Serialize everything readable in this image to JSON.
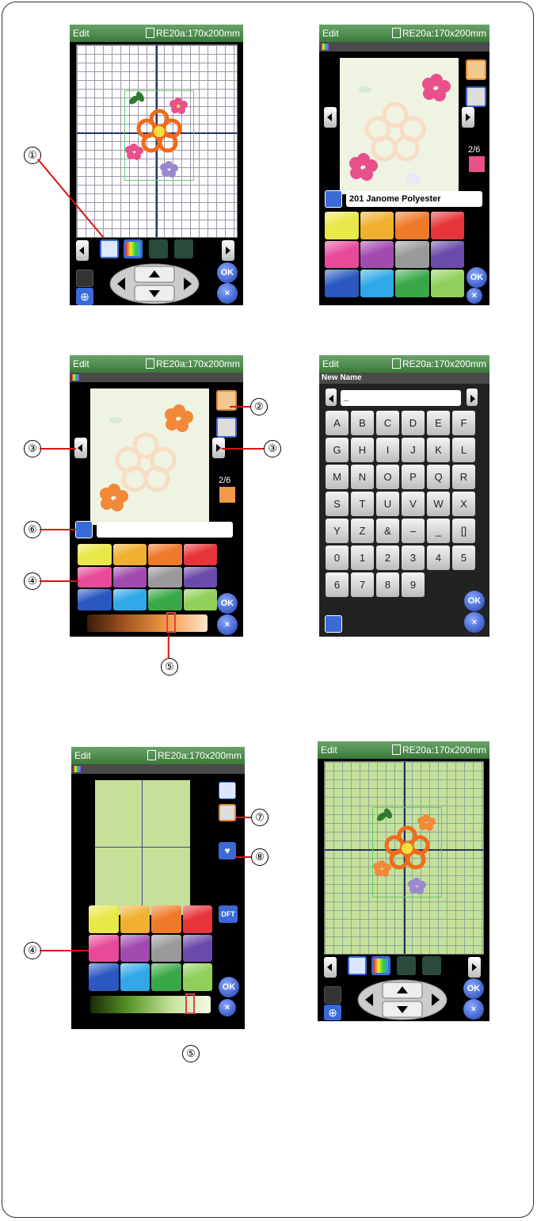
{
  "header": {
    "mode": "Edit",
    "format": "RE20a:170x200mm"
  },
  "panel_b": {
    "page": "2/6",
    "thread_name": "201 Janome Polyester"
  },
  "panel_c": {
    "page": "2/6",
    "thread_name": ""
  },
  "panel_d": {
    "title": "New Name",
    "input_value": "_",
    "keys": [
      "A",
      "B",
      "C",
      "D",
      "E",
      "F",
      "G",
      "H",
      "I",
      "J",
      "K",
      "L",
      "M",
      "N",
      "O",
      "P",
      "Q",
      "R",
      "S",
      "T",
      "U",
      "V",
      "W",
      "X",
      "Y",
      "Z",
      "&",
      "–",
      "_",
      "[]",
      "0",
      "1",
      "2",
      "3",
      "4",
      "5",
      "6",
      "7",
      "8",
      "9"
    ]
  },
  "panel_e": {
    "dft_label": "DFT"
  },
  "buttons": {
    "ok": "OK",
    "cancel": "×"
  },
  "callouts": {
    "c1": "①",
    "c2": "②",
    "c3": "③",
    "c4": "④",
    "c5": "⑤",
    "c6": "⑥",
    "c7": "⑦",
    "c8": "⑧"
  },
  "swatch_colors": [
    "#e8e84a",
    "#f0b030",
    "#ee7a2a",
    "#e6353a",
    "#e84a9a",
    "#a24ab0",
    "#9a9a9a",
    "#6a4aaa",
    "#2a58c0",
    "#30a8e8",
    "#3aa848",
    "#90d05a"
  ],
  "colors": {
    "flower_orange": "#f06a1a",
    "flower_pink": "#e8508a",
    "flower_purple": "#9a88d0",
    "leaf": "#2e7a2e",
    "bg_green": "#c6e09a"
  }
}
